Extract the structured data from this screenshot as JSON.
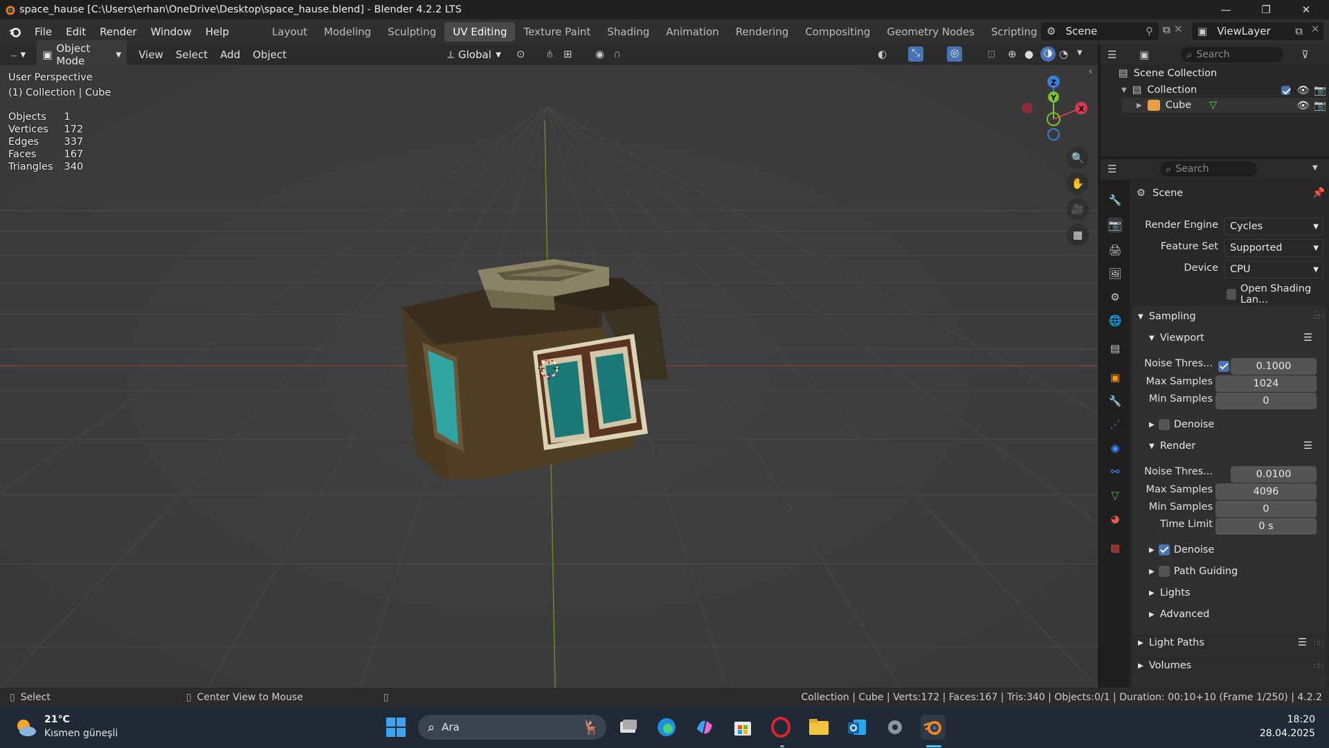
{
  "window": {
    "title": "space_hause [C:\\Users\\erhan\\OneDrive\\Desktop\\space_hause.blend] - Blender 4.2.2 LTS",
    "controls": [
      "—",
      "❐",
      "✕"
    ]
  },
  "menubar": {
    "menus": [
      "File",
      "Edit",
      "Render",
      "Window",
      "Help"
    ],
    "workspaces": [
      "Layout",
      "Modeling",
      "Sculpting",
      "UV Editing",
      "Texture Paint",
      "Shading",
      "Animation",
      "Rendering",
      "Compositing",
      "Geometry Nodes",
      "Scripting"
    ],
    "active_workspace": "UV Editing",
    "add_tab": "+",
    "scene_name": "Scene",
    "view_layer": "ViewLayer"
  },
  "viewport_header": {
    "mode": "Object Mode",
    "menus": [
      "View",
      "Select",
      "Add",
      "Object"
    ],
    "transform_orientation": "Global"
  },
  "viewport": {
    "perspective": "User Perspective",
    "active_info": "(1) Collection | Cube",
    "stats": [
      {
        "label": "Objects",
        "value": "1"
      },
      {
        "label": "Vertices",
        "value": "172"
      },
      {
        "label": "Edges",
        "value": "337"
      },
      {
        "label": "Faces",
        "value": "167"
      },
      {
        "label": "Triangles",
        "value": "340"
      }
    ],
    "gizmo_axes": {
      "z": "Z",
      "y": "Y",
      "x": "X"
    },
    "colors": {
      "x_axis": "#d6394f",
      "y_axis": "#79c227",
      "z_axis": "#3c7fd6",
      "bg": "#3f3f3f"
    }
  },
  "outliner": {
    "search_placeholder": "Search",
    "root": "Scene Collection",
    "collection": "Collection",
    "object": "Cube"
  },
  "properties": {
    "search_placeholder": "Search",
    "context": "Scene",
    "render_engine_label": "Render Engine",
    "render_engine": "Cycles",
    "feature_set_label": "Feature Set",
    "feature_set": "Supported",
    "device_label": "Device",
    "device": "CPU",
    "osl_label": "Open Shading Lan...",
    "sampling": {
      "title": "Sampling",
      "viewport": {
        "title": "Viewport",
        "noise_label": "Noise Thres...",
        "noise_value": "0.1000",
        "max_label": "Max Samples",
        "max_value": "1024",
        "min_label": "Min Samples",
        "min_value": "0",
        "denoise_label": "Denoise",
        "denoise_enabled": false
      },
      "render": {
        "title": "Render",
        "noise_label": "Noise Thres...",
        "noise_value": "0.0100",
        "max_label": "Max Samples",
        "max_value": "4096",
        "min_label": "Min Samples",
        "min_value": "0",
        "time_label": "Time Limit",
        "time_value": "0 s",
        "denoise_label": "Denoise",
        "denoise_enabled": true
      },
      "path_guiding": "Path Guiding",
      "lights": "Lights",
      "advanced": "Advanced"
    },
    "light_paths": "Light Paths",
    "volumes": "Volumes"
  },
  "statusbar": {
    "left_action": "Select",
    "middle_action": "Center View to Mouse",
    "info": "Collection | Cube | Verts:172 | Faces:167 | Tris:340 | Objects:0/1 | Duration: 00:10+10 (Frame 1/250) | 4.2.2"
  },
  "taskbar": {
    "temperature": "21°C",
    "weather": "Kısmen güneşli",
    "search_label": "Ara",
    "time": "18:20",
    "date": "28.04.2025"
  }
}
